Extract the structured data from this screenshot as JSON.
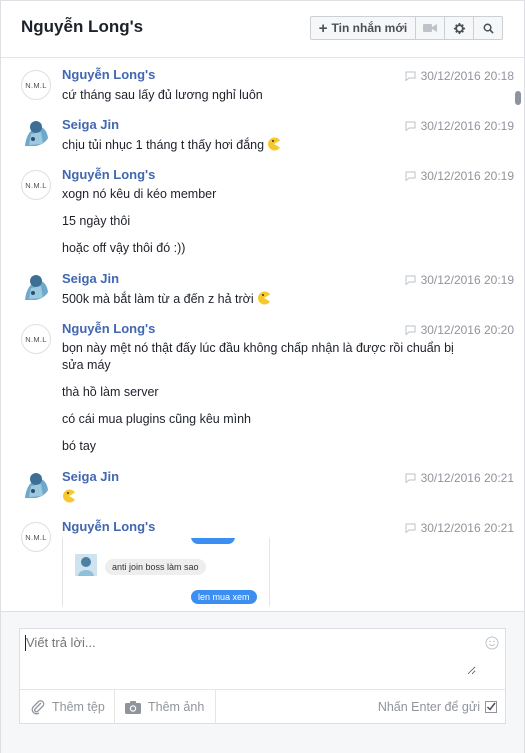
{
  "header": {
    "title": "Nguyễn Long's",
    "new_message_label": "Tin nhắn mới",
    "icons": [
      "video-icon",
      "gear-icon",
      "search-icon"
    ]
  },
  "colors": {
    "sender": "#4267b2",
    "timestamp": "#90949c",
    "bubble_blue": "#3b8ff2"
  },
  "groups": [
    {
      "sender": "Nguyễn Long's",
      "avatar": "N.M.L",
      "time": "30/12/2016 20:18",
      "messages": [
        "cứ tháng sau lấy đủ lương nghỉ luôn"
      ]
    },
    {
      "sender": "Seiga Jin",
      "time": "30/12/2016 20:19",
      "messages": [
        "chịu tủi nhục 1 tháng t thấy hơi đắng"
      ]
    },
    {
      "sender": "Nguyễn Long's",
      "avatar": "N.M.L",
      "time": "30/12/2016 20:19",
      "messages": [
        "xogn nó kêu di kéo member",
        "15 ngày thôi",
        "hoặc off vậy thôi đó :))"
      ]
    },
    {
      "sender": "Seiga Jin",
      "time": "30/12/2016 20:19",
      "messages": [
        "500k mà bắt làm từ a đến z hả trời"
      ]
    },
    {
      "sender": "Nguyễn Long's",
      "avatar": "N.M.L",
      "time": "30/12/2016 20:20",
      "messages": [
        "bọn này mệt nó thật đấy lúc đầu không chấp nhận là được rồi chuẩn bị sửa máy",
        "thà hồ làm server",
        "có cái mua plugins cũng kêu mình",
        "bó tay"
      ]
    },
    {
      "sender": "Seiga Jin",
      "time": "30/12/2016 20:21",
      "messages": []
    },
    {
      "sender": "Nguyễn Long's",
      "avatar": "N.M.L",
      "time": "30/12/2016 20:21",
      "attachment": {
        "grey_bubble": "anti join boss làm sao",
        "blue_bubble": "len mua xem"
      }
    }
  ],
  "composer": {
    "placeholder": "Viết trả lời...",
    "add_file": "Thêm tệp",
    "add_photo": "Thêm ảnh",
    "enter_to_send": "Nhấn Enter để gửi",
    "enter_to_send_checked": true
  }
}
